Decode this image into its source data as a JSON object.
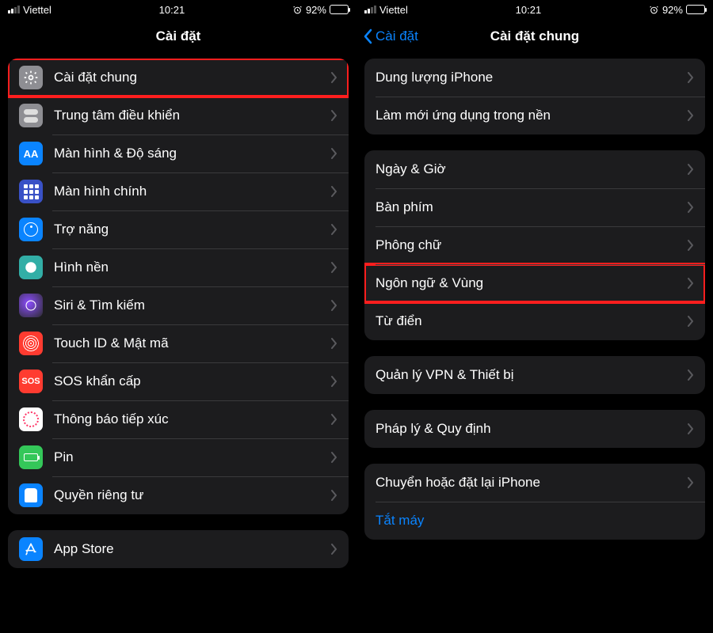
{
  "status": {
    "carrier": "Viettel",
    "time": "10:21",
    "battery_pct": "92%"
  },
  "left": {
    "title": "Cài đặt",
    "group1": [
      {
        "label": "Cài đặt chung",
        "icon": "general",
        "highlight": true
      },
      {
        "label": "Trung tâm điều khiển",
        "icon": "control"
      },
      {
        "label": "Màn hình & Độ sáng",
        "icon": "display"
      },
      {
        "label": "Màn hình chính",
        "icon": "home"
      },
      {
        "label": "Trợ năng",
        "icon": "access"
      },
      {
        "label": "Hình nền",
        "icon": "wall"
      },
      {
        "label": "Siri & Tìm kiếm",
        "icon": "siri"
      },
      {
        "label": "Touch ID & Mật mã",
        "icon": "touch"
      },
      {
        "label": "SOS khẩn cấp",
        "icon": "sos",
        "text": "SOS"
      },
      {
        "label": "Thông báo tiếp xúc",
        "icon": "exposure"
      },
      {
        "label": "Pin",
        "icon": "battery"
      },
      {
        "label": "Quyền riêng tư",
        "icon": "privacy"
      }
    ],
    "group2": [
      {
        "label": "App Store",
        "icon": "appstore"
      }
    ]
  },
  "right": {
    "back": "Cài đặt",
    "title": "Cài đặt chung",
    "group1": [
      {
        "label": "Dung lượng iPhone"
      },
      {
        "label": "Làm mới ứng dụng trong nền"
      }
    ],
    "group2": [
      {
        "label": "Ngày & Giờ"
      },
      {
        "label": "Bàn phím"
      },
      {
        "label": "Phông chữ"
      },
      {
        "label": "Ngôn ngữ & Vùng",
        "highlight": true
      },
      {
        "label": "Từ điển"
      }
    ],
    "group3": [
      {
        "label": "Quản lý VPN & Thiết bị"
      }
    ],
    "group4": [
      {
        "label": "Pháp lý & Quy định"
      }
    ],
    "group5": [
      {
        "label": "Chuyển hoặc đặt lại iPhone"
      },
      {
        "label": "Tắt máy",
        "link": true
      }
    ]
  }
}
